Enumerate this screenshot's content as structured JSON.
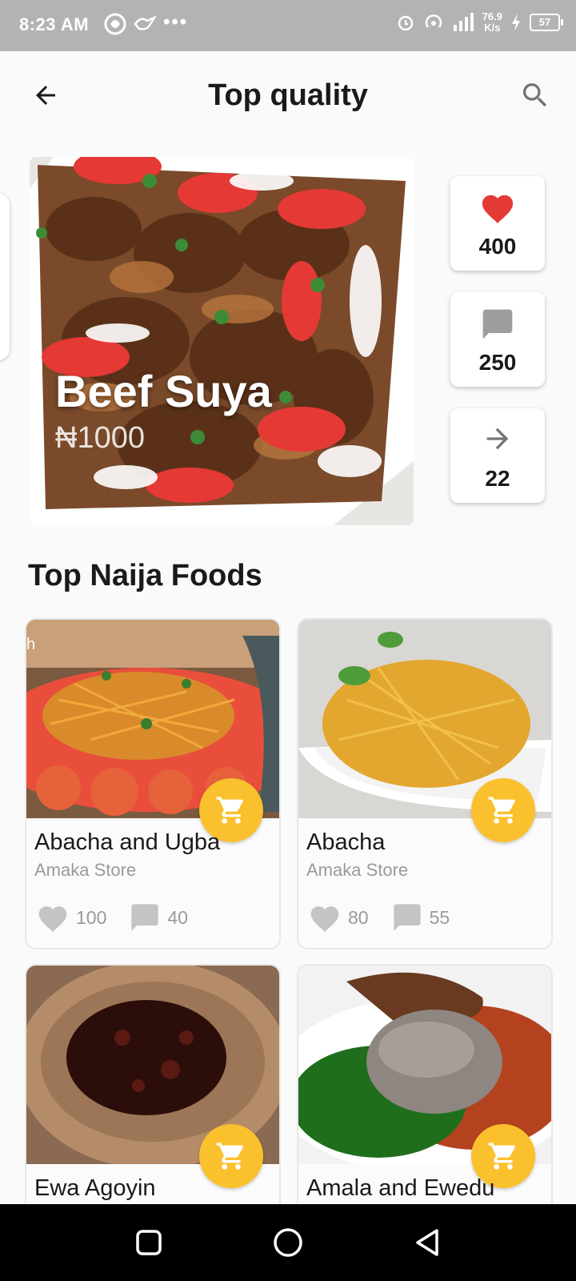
{
  "status_bar": {
    "time": "8:23 AM",
    "speed_value": "76.9",
    "speed_unit": "K/s",
    "battery": "57"
  },
  "app_bar": {
    "title": "Top quality"
  },
  "featured": {
    "name": "Beef Suya",
    "price": "₦1000"
  },
  "stats": {
    "likes": "400",
    "comments": "250",
    "shares": "22"
  },
  "section": {
    "title": "Top Naija Foods"
  },
  "foods": [
    {
      "name": "Abacha and Ugba",
      "store": "Amaka Store",
      "likes": "100",
      "comments": "40",
      "overlay_text": "h"
    },
    {
      "name": "Abacha",
      "store": "Amaka Store",
      "likes": "80",
      "comments": "55"
    },
    {
      "name": "Ewa Agoyin",
      "store": ""
    },
    {
      "name": "Amala and Ewedu",
      "store": ""
    }
  ],
  "colors": {
    "accent": "#fbc02d",
    "like": "#e53935",
    "status_bar": "#b3b3b3"
  }
}
